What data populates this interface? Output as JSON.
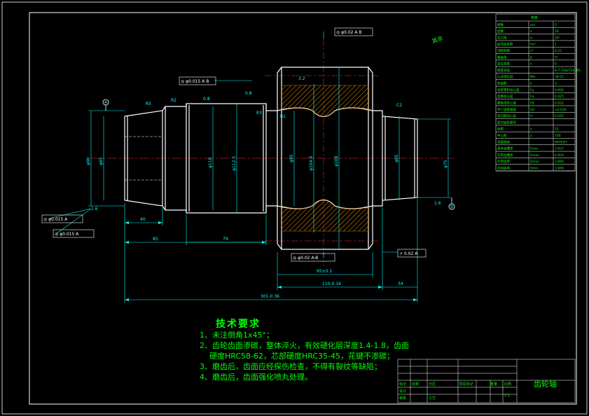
{
  "colors": {
    "background": "#000000",
    "frame": "#ffffff",
    "geometry": "#ffffff",
    "dimension": "#00ffff",
    "centerline": "#ff3333",
    "hatch": "#ff9900",
    "text_green": "#00ff00"
  },
  "labels": {
    "datum_a": "A",
    "datum_b": "B",
    "r2_a": "R2",
    "r2_b": "R2",
    "r3": "R3",
    "r1": "R1",
    "r5": "R5",
    "chamfer": "C2",
    "ra_16": "1.6",
    "ra_08a": "0.8",
    "ra_08b": "0.8",
    "ra_16b": "1.6",
    "ra_32": "3.2",
    "d_110": "φ110",
    "d_112": "φ112.5",
    "d_95": "φ95",
    "d_104": "φ104.8",
    "d_108": "φ108",
    "d_85": "φ85",
    "d_left1": "φ90",
    "d_left2": "φ85",
    "d_right": "φ75",
    "len_40": "40",
    "len_85": "85",
    "len_79": "79",
    "len_95": "95±0.1",
    "len_110": "110-0.16",
    "len_34": "34",
    "len_total": "301-0.36"
  },
  "gdt": {
    "top_tol": "◎ φ0.02 A B",
    "mid_tol": "◎ φ0.015 A B",
    "left_tol1": "◎ φ0.015 A",
    "left_tol2": "◎ φ0.015 A",
    "bottom_tol": "◎ φ0.02 A-B",
    "right_tol": "↗ 0.02 A"
  },
  "notes": {
    "title": "技术要求",
    "items": [
      "1、未注倒角1x45°；",
      "2、齿轮齿面渗碳，整体淬火，有效硬化层深度1.4-1.8，齿面",
      "硬度HRC58-62，芯部硬度HRC35-45，花键不渗碳；",
      "3、磨齿后，齿面应经探伤检查，不得有裂纹等缺陷；",
      "4、磨齿后，齿面强化喷丸处理。"
    ]
  },
  "title_block": {
    "part_name": "齿轮轴",
    "scale": "1:1",
    "row_labels": [
      "标记",
      "处数",
      "分区",
      "更改文件号",
      "签名",
      "年、月、日"
    ],
    "head_labels": [
      "阶段标记",
      "重量",
      "比例"
    ],
    "sign_labels": [
      "设计",
      "审核",
      "工艺",
      "批准"
    ]
  },
  "param_table": {
    "header": "参数",
    "rows": [
      [
        "模数",
        "mn",
        "5"
      ],
      [
        "齿数",
        "z",
        "18"
      ],
      [
        "压力角",
        "α",
        "20°"
      ],
      [
        "齿顶高系数",
        "ha*",
        "1"
      ],
      [
        "顶隙系数",
        "c*",
        "0.25"
      ],
      [
        "螺旋角",
        "β",
        "0°"
      ],
      [
        "变位系数",
        "x",
        "0"
      ],
      [
        "精度等级",
        "",
        "8-7-7GB/T10095"
      ],
      [
        "公法线长度",
        "Wk",
        "38.51"
      ],
      [
        "跨齿数",
        "k",
        "3"
      ],
      [
        "齿距累积总公差",
        "Fp",
        "0.056"
      ],
      [
        "齿廓总公差",
        "Fα",
        "0.025"
      ],
      [
        "螺旋线总公差",
        "Fβ",
        "0.022"
      ],
      [
        "单个齿距偏差",
        "fpt",
        "±0.016"
      ],
      [
        "径向跳动公差",
        "Fr",
        "0.045"
      ],
      [
        "配对齿轮图号",
        "",
        ""
      ],
      [
        "齿数",
        "z",
        "22"
      ],
      [
        "中心距",
        "a",
        "100"
      ],
      [
        "花键规格",
        "",
        "INT/EXT"
      ],
      [
        "基本齿槽宽",
        "Emin",
        "3.927"
      ],
      [
        "实际齿槽宽",
        "Emax",
        "4.000"
      ],
      [
        "作用齿厚",
        "Smax",
        "3.880"
      ],
      [
        "实际齿厚",
        "Smin",
        "3.840"
      ]
    ]
  },
  "corner_mark": "其余"
}
